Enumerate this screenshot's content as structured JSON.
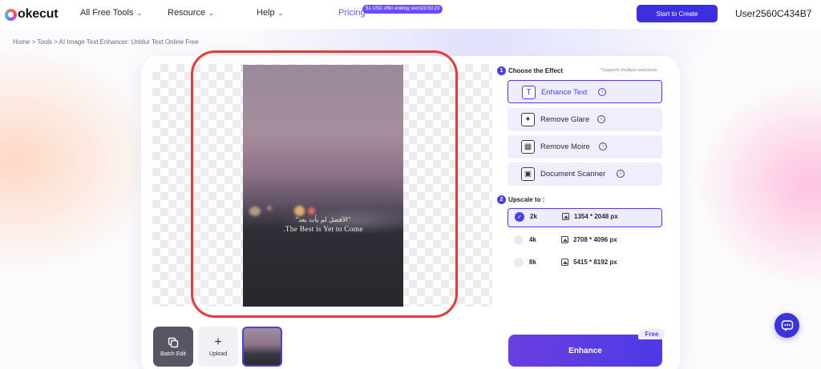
{
  "brand": {
    "logo_text": "okecut"
  },
  "nav": {
    "items": [
      {
        "label": "All Free Tools"
      },
      {
        "label": "Resource"
      },
      {
        "label": "Help"
      }
    ],
    "pricing_label": "Pricing",
    "promo_badge": "$1 USD offer ending soon23:50:23",
    "cta_label": "Start to Create",
    "username": "User2560C434B7"
  },
  "breadcrumb": "Home > Tools > AI Image Text Enhancer: Unblur Text Online Free",
  "photo": {
    "arabic_text": "\"الأفضل لم يأت بعد\"",
    "caption": ".The Best is Yet to Come"
  },
  "tray": {
    "batch_edit_label": "Batch Edit",
    "upload_label": "Upload"
  },
  "panel": {
    "step1": {
      "number": "1",
      "title": "Choose the Effect",
      "note": "*Supports multiple selections"
    },
    "effects": [
      {
        "label": "Enhance Text",
        "icon": "text-icon",
        "selected": true
      },
      {
        "label": "Remove Glare",
        "icon": "glare-icon",
        "selected": false
      },
      {
        "label": "Remove Moire",
        "icon": "moire-icon",
        "selected": false
      },
      {
        "label": "Document Scanner",
        "icon": "scanner-icon",
        "selected": false
      }
    ],
    "step2": {
      "number": "2",
      "title": "Upscale to :"
    },
    "scales": [
      {
        "label": "2k",
        "resolution": "1354 * 2048 px",
        "selected": true
      },
      {
        "label": "4k",
        "resolution": "2708 * 4096 px",
        "selected": false
      },
      {
        "label": "8k",
        "resolution": "5415 * 8192 px",
        "selected": false
      }
    ],
    "enhance_label": "Enhance",
    "free_badge": "Free"
  },
  "colors": {
    "accent": "#4a3fe6",
    "highlight_outline": "#e53a3a",
    "cta": "#3b2fe0"
  }
}
